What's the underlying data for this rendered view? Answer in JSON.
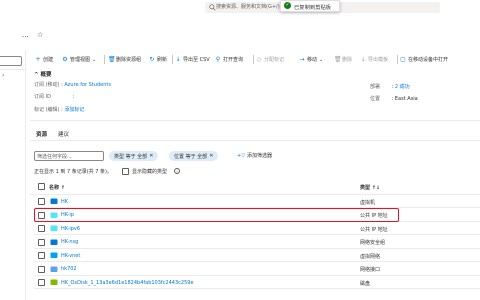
{
  "topbar": {
    "search_placeholder": "搜索资源、服务和文档(G+/)",
    "toast_text": "已复制到剪贴板"
  },
  "title": {
    "more": "...",
    "star": "☆"
  },
  "toolbar": {
    "items": [
      {
        "icon": "+",
        "label": "创建",
        "disabled": false
      },
      {
        "icon": "⚙",
        "label": "管理视图",
        "chevron": "⌄",
        "disabled": false
      },
      {
        "icon": "🗑",
        "label": "删除资源组",
        "disabled": false
      },
      {
        "icon": "↻",
        "label": "刷新",
        "disabled": false
      },
      {
        "icon": "↓",
        "label": "导出至 CSV",
        "disabled": false
      },
      {
        "icon": "⚲",
        "label": "打开查询",
        "disabled": false
      },
      {
        "icon": "◇",
        "label": "分配标记",
        "disabled": true
      },
      {
        "icon": "→",
        "label": "移动",
        "chevron": "⌄",
        "disabled": false
      },
      {
        "icon": "🗑",
        "label": "删除",
        "disabled": true
      },
      {
        "icon": "↓",
        "label": "导出模板",
        "disabled": true
      },
      {
        "icon": "▢",
        "label": "在移动设备中打开",
        "disabled": false
      }
    ]
  },
  "essentials": {
    "header": "^ 概要",
    "subscription_label": "订阅 (移动)",
    "subscription_value": "Azure for Students",
    "subscription_id_label": "订阅 ID",
    "subscription_id_value": ":",
    "tags_label": "标记 (编辑)",
    "tags_link": "添加标记",
    "deployments_label": "部署",
    "deployments_value": "2 成功",
    "location_label": "位置",
    "location_value": "East Asia"
  },
  "tabs": [
    {
      "label": "资源",
      "active": true
    },
    {
      "label": "建议",
      "active": false
    }
  ],
  "filters": {
    "search_placeholder": "筛选任何字段...",
    "pills": [
      {
        "label": "类型 等于 全部",
        "x": "✕"
      },
      {
        "label": "位置 等于 全部",
        "x": "✕"
      }
    ],
    "add_filter": "添加筛选器"
  },
  "records": {
    "count_text": "正在显示 1 到 7 条记录(共 7 条)。",
    "show_hidden_label": "显示隐藏的类型",
    "info": "i"
  },
  "table": {
    "headers": {
      "name": "名称 ↑",
      "type": "类型 ↑↓"
    },
    "rows": [
      {
        "name": "HK",
        "type": "虚拟机",
        "icon": "vm-icon",
        "color": "#0078d4"
      },
      {
        "name": "HK-ip",
        "type": "公共 IP 地址",
        "icon": "public-ip-icon",
        "color": "#50e6ff"
      },
      {
        "name": "HK-ipv6",
        "type": "公共 IP 地址",
        "icon": "public-ip-icon",
        "color": "#50e6ff"
      },
      {
        "name": "HK-nsg",
        "type": "网络安全组",
        "icon": "nsg-icon",
        "color": "#0078d4"
      },
      {
        "name": "HK-vnet",
        "type": "虚拟网络",
        "icon": "vnet-icon",
        "color": "#00a4ef"
      },
      {
        "name": "hk702",
        "type": "网络接口",
        "icon": "nic-icon",
        "color": "#5ea0ef"
      },
      {
        "name": "HK_OsDisk_1_13a3e6d1e1824b4fab103fc2443c259e",
        "type": "磁盘",
        "icon": "disk-icon",
        "color": "#7fba00"
      }
    ]
  },
  "colors": {
    "accent": "#0078d4",
    "highlight": "#e81123",
    "success": "#107c10"
  }
}
